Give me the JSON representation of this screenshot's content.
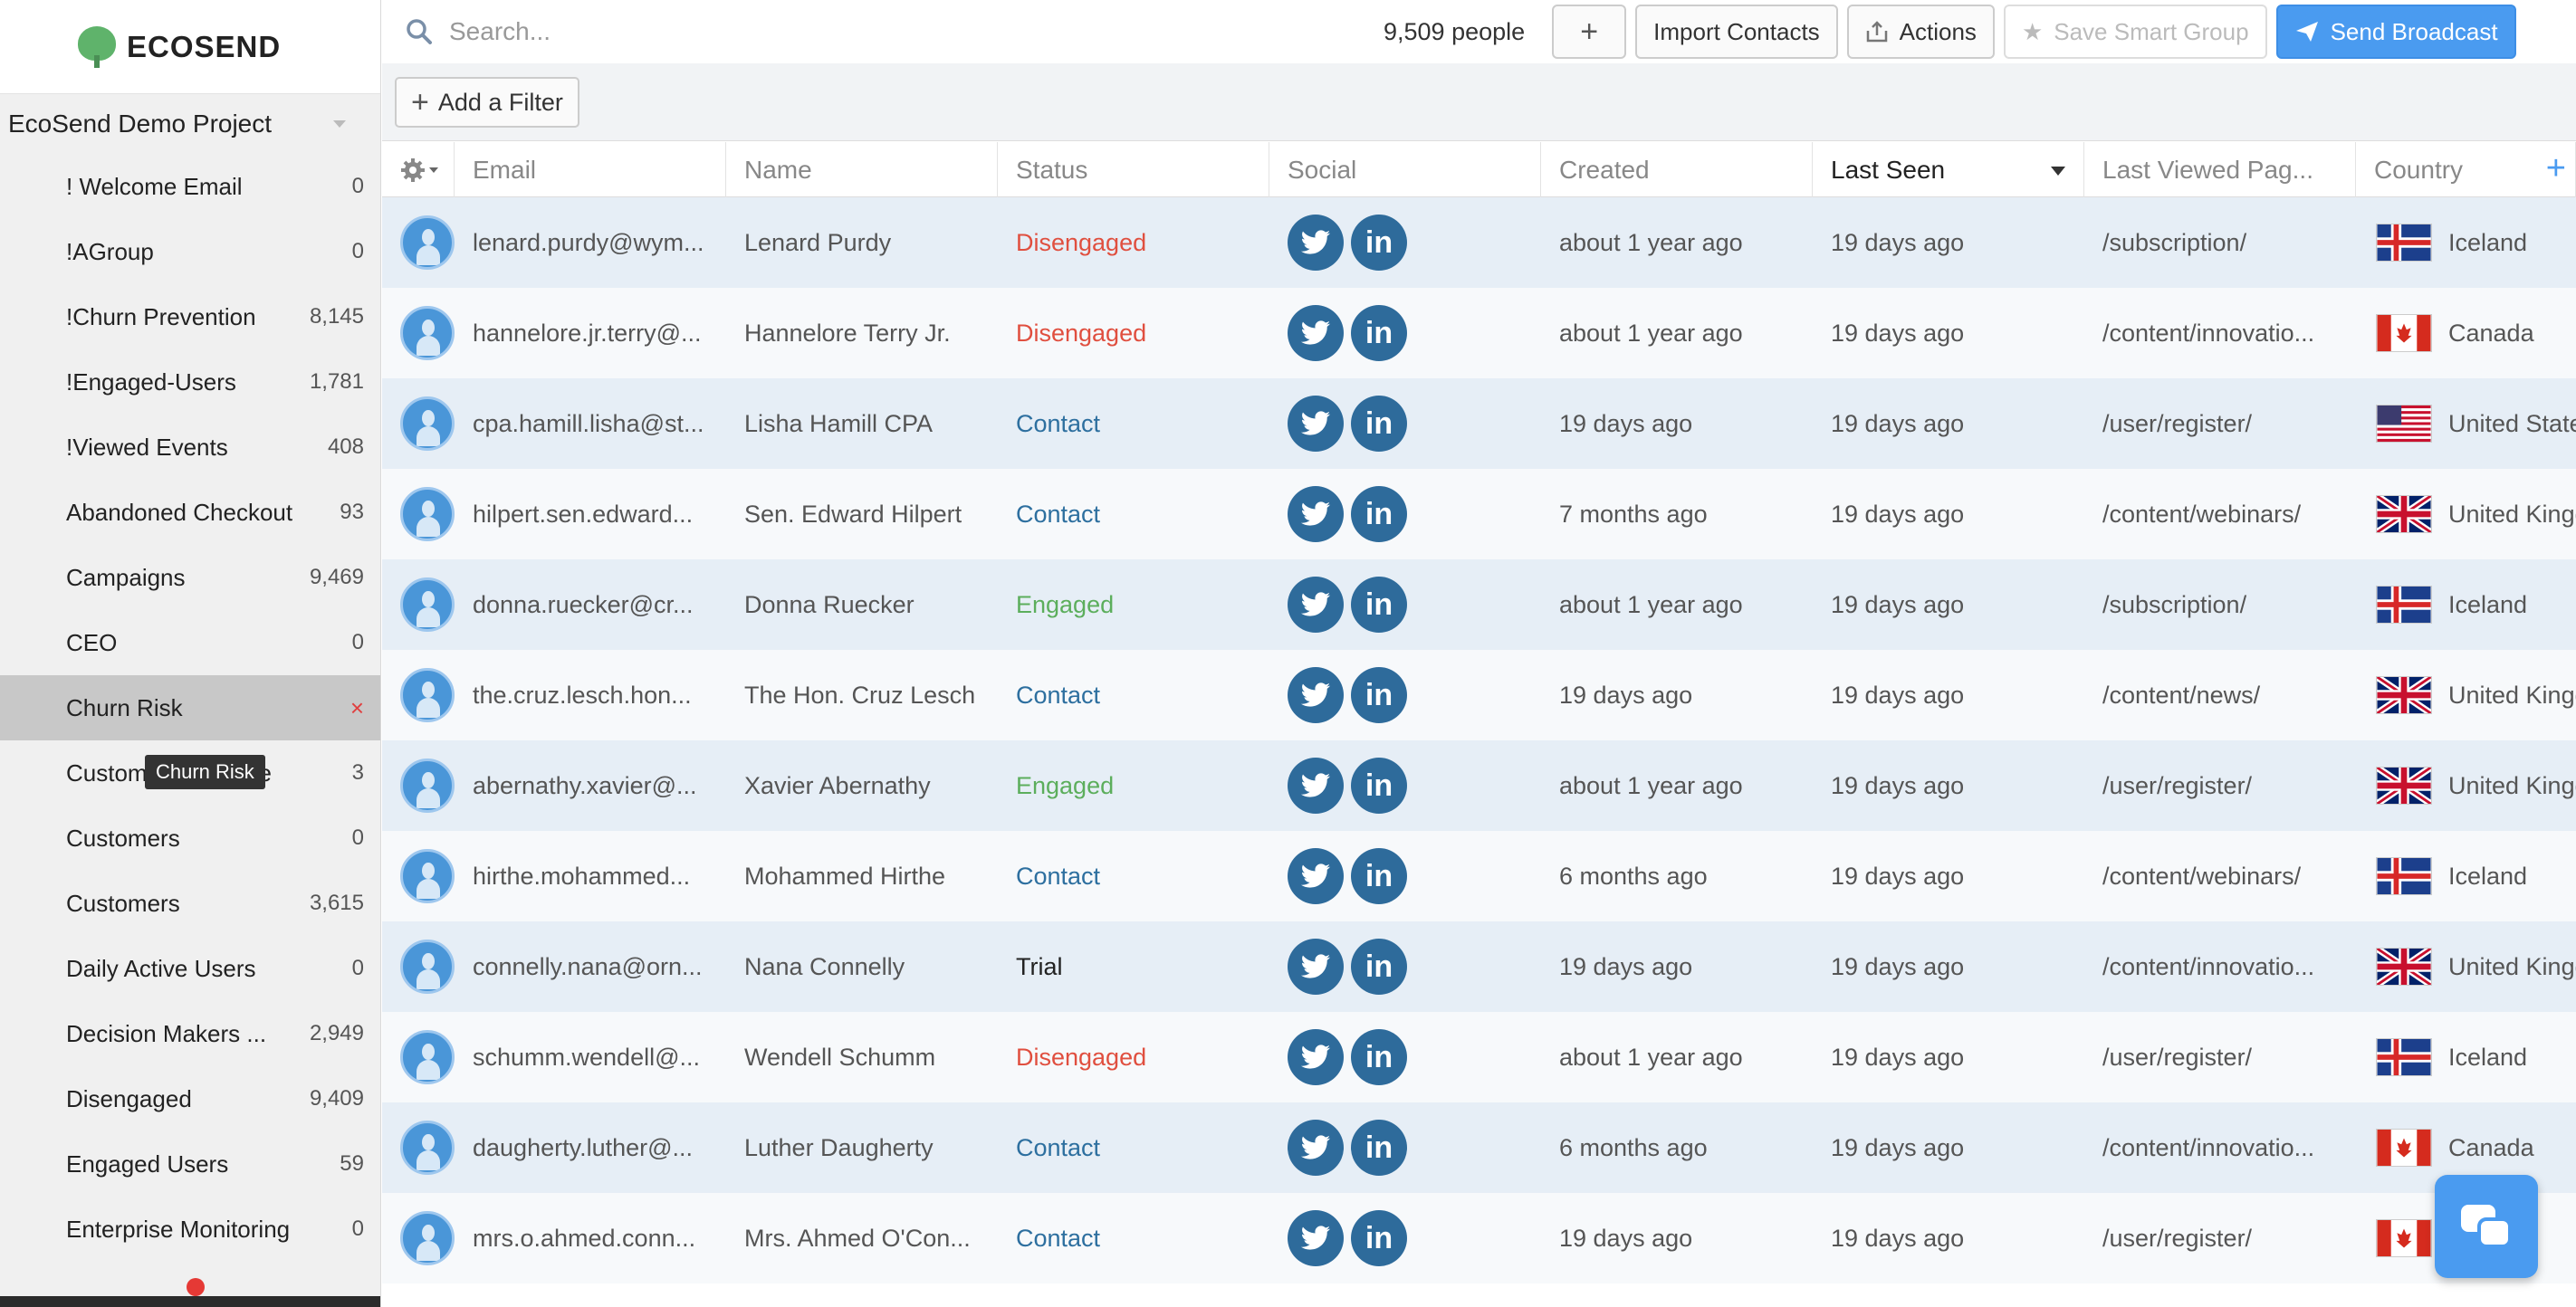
{
  "brand": {
    "name": "ECOSEND"
  },
  "project": {
    "name": "EcoSend Demo Project"
  },
  "sidebar": {
    "items": [
      {
        "label": "! Welcome Email",
        "count": "0"
      },
      {
        "label": "!AGroup",
        "count": "0"
      },
      {
        "label": "!Churn Prevention",
        "count": "8,145"
      },
      {
        "label": "!Engaged-Users",
        "count": "1,781"
      },
      {
        "label": "!Viewed Events",
        "count": "408"
      },
      {
        "label": "Abandoned Checkout",
        "count": "93"
      },
      {
        "label": "Campaigns",
        "count": "9,469"
      },
      {
        "label": "CEO",
        "count": "0"
      },
      {
        "label": "Churn Risk",
        "count": "×",
        "active": true
      },
      {
        "label": "Customer Audience",
        "count": "3"
      },
      {
        "label": "Customers",
        "count": "0"
      },
      {
        "label": "Customers",
        "count": "3,615"
      },
      {
        "label": "Daily Active Users",
        "count": "0"
      },
      {
        "label": "Decision Makers ...",
        "count": "2,949"
      },
      {
        "label": "Disengaged",
        "count": "9,409"
      },
      {
        "label": "Engaged Users",
        "count": "59"
      },
      {
        "label": "Enterprise Monitoring",
        "count": "0"
      }
    ],
    "tooltip": "Churn Risk"
  },
  "topbar": {
    "search_placeholder": "Search...",
    "people_count": "9,509 people",
    "plus_label": "+",
    "import_label": "Import Contacts",
    "actions_label": "Actions",
    "save_label": "Save Smart Group",
    "send_label": "Send Broadcast"
  },
  "filter": {
    "add_label": "Add a Filter"
  },
  "table": {
    "columns": [
      "Email",
      "Name",
      "Status",
      "Social",
      "Created",
      "Last Seen",
      "Last Viewed Pag...",
      "Country"
    ],
    "sorted_column": "Last Seen",
    "rows": [
      {
        "email": "lenard.purdy@wym...",
        "name": "Lenard Purdy",
        "status": "Disengaged",
        "created": "about 1 year ago",
        "last_seen": "19 days ago",
        "page": "/subscription/",
        "country": "Iceland",
        "flag": "is"
      },
      {
        "email": "hannelore.jr.terry@...",
        "name": "Hannelore Terry Jr.",
        "status": "Disengaged",
        "created": "about 1 year ago",
        "last_seen": "19 days ago",
        "page": "/content/innovatio...",
        "country": "Canada",
        "flag": "ca"
      },
      {
        "email": "cpa.hamill.lisha@st...",
        "name": "Lisha Hamill CPA",
        "status": "Contact",
        "created": "19 days ago",
        "last_seen": "19 days ago",
        "page": "/user/register/",
        "country": "United States",
        "flag": "us"
      },
      {
        "email": "hilpert.sen.edward...",
        "name": "Sen. Edward Hilpert",
        "status": "Contact",
        "created": "7 months ago",
        "last_seen": "19 days ago",
        "page": "/content/webinars/",
        "country": "United Kingdom",
        "flag": "gb"
      },
      {
        "email": "donna.ruecker@cr...",
        "name": "Donna Ruecker",
        "status": "Engaged",
        "created": "about 1 year ago",
        "last_seen": "19 days ago",
        "page": "/subscription/",
        "country": "Iceland",
        "flag": "is"
      },
      {
        "email": "the.cruz.lesch.hon...",
        "name": "The Hon. Cruz Lesch",
        "status": "Contact",
        "created": "19 days ago",
        "last_seen": "19 days ago",
        "page": "/content/news/",
        "country": "United Kingdom",
        "flag": "gb"
      },
      {
        "email": "abernathy.xavier@...",
        "name": "Xavier Abernathy",
        "status": "Engaged",
        "created": "about 1 year ago",
        "last_seen": "19 days ago",
        "page": "/user/register/",
        "country": "United Kingdom",
        "flag": "gb"
      },
      {
        "email": "hirthe.mohammed...",
        "name": "Mohammed Hirthe",
        "status": "Contact",
        "created": "6 months ago",
        "last_seen": "19 days ago",
        "page": "/content/webinars/",
        "country": "Iceland",
        "flag": "is"
      },
      {
        "email": "connelly.nana@orn...",
        "name": "Nana Connelly",
        "status": "Trial",
        "created": "19 days ago",
        "last_seen": "19 days ago",
        "page": "/content/innovatio...",
        "country": "United Kingdom",
        "flag": "gb"
      },
      {
        "email": "schumm.wendell@...",
        "name": "Wendell Schumm",
        "status": "Disengaged",
        "created": "about 1 year ago",
        "last_seen": "19 days ago",
        "page": "/user/register/",
        "country": "Iceland",
        "flag": "is"
      },
      {
        "email": "daugherty.luther@...",
        "name": "Luther Daugherty",
        "status": "Contact",
        "created": "6 months ago",
        "last_seen": "19 days ago",
        "page": "/content/innovatio...",
        "country": "Canada",
        "flag": "ca"
      },
      {
        "email": "mrs.o.ahmed.conn...",
        "name": "Mrs. Ahmed O'Con...",
        "status": "Contact",
        "created": "19 days ago",
        "last_seen": "19 days ago",
        "page": "/user/register/",
        "country": "",
        "flag": "ca"
      }
    ]
  },
  "colors": {
    "primary": "#4a9bf0",
    "disengaged": "#e04f3f",
    "contact": "#2d6f9f",
    "engaged": "#5cae5c",
    "social": "#2e6b9b"
  }
}
